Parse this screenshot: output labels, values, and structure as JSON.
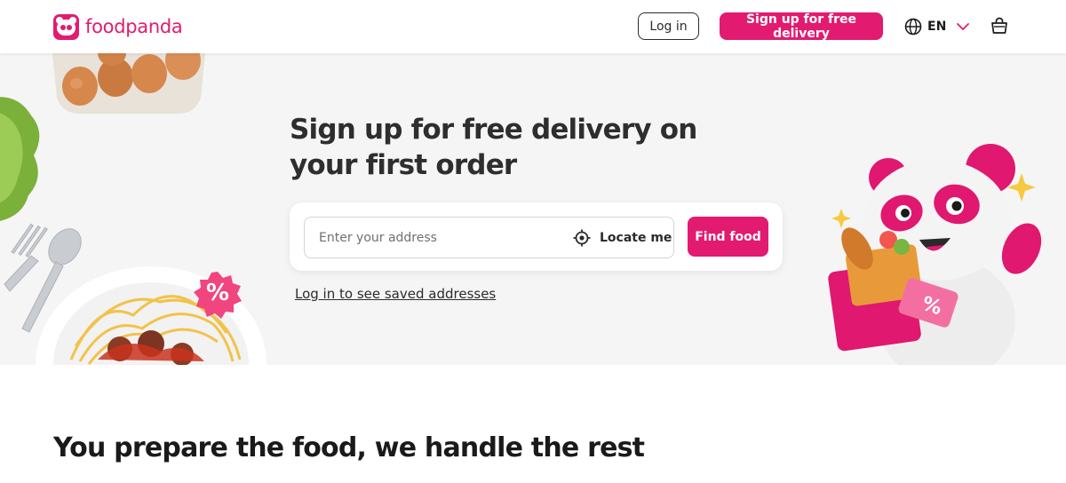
{
  "header": {
    "brand": "foodpanda",
    "login_label": "Log in",
    "signup_label": "Sign up for free delivery",
    "language_label": "EN",
    "icons": {
      "logo": "panda-logo-icon",
      "language": "globe-icon",
      "language_caret": "chevron-down-icon",
      "cart": "shopping-bag-icon"
    }
  },
  "hero": {
    "title": "Sign up for free delivery on your first order",
    "address_placeholder": "Enter your address",
    "address_value": "",
    "locate_label": "Locate me",
    "locate_icon": "crosshair-icon",
    "find_label": "Find food",
    "saved_addresses_link": "Log in to see saved addresses",
    "promo_badge_left": "%",
    "promo_badge_right": "%"
  },
  "section": {
    "title": "You prepare the food, we handle the rest"
  },
  "colors": {
    "brand_pink": "#e21b70",
    "hero_background": "#f5f5f5",
    "text_dark": "#2e2e2e"
  }
}
